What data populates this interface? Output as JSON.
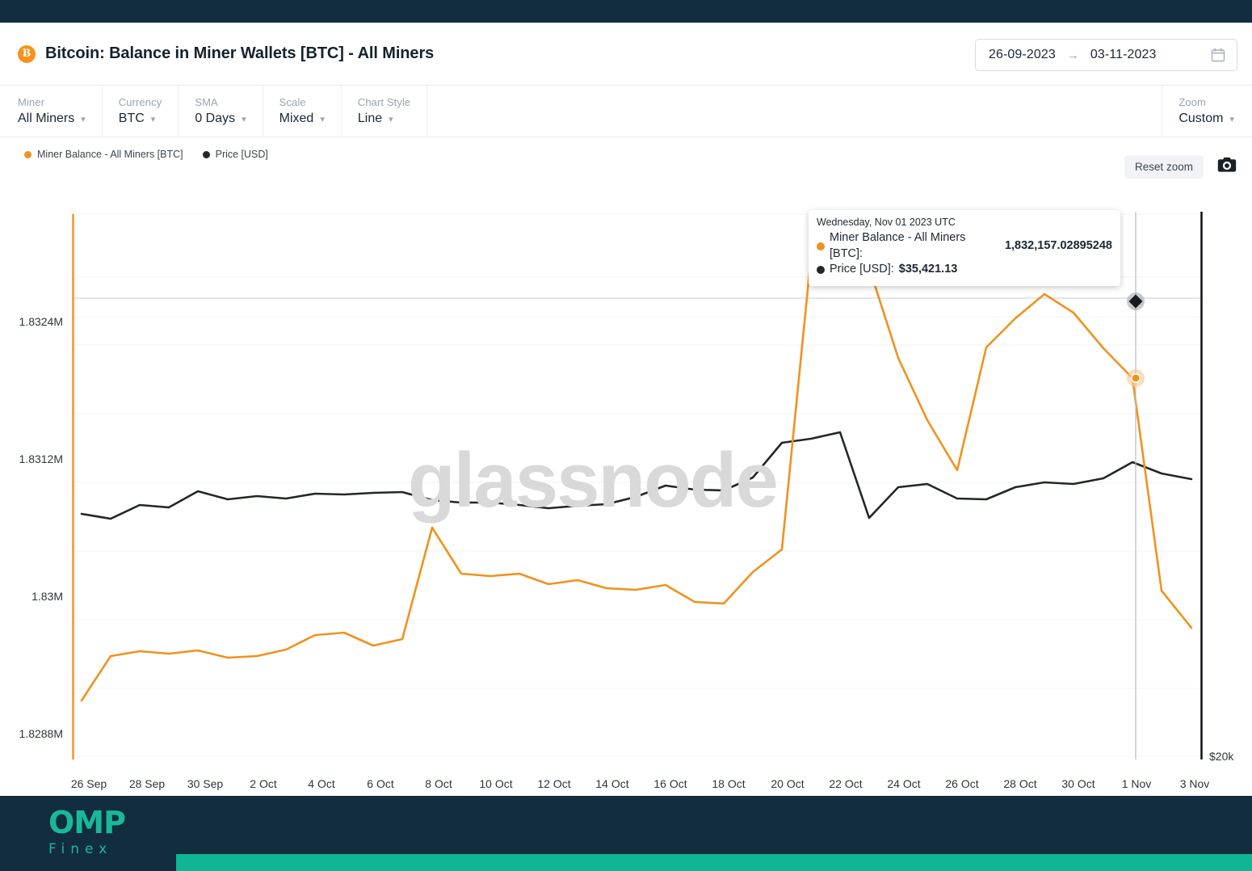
{
  "header": {
    "title": "Bitcoin: Balance in Miner Wallets [BTC] - All Miners",
    "asset_icon": "bitcoin-icon",
    "asset_glyph": "Ƀ",
    "date_from": "26-09-2023",
    "date_to": "03-11-2023",
    "date_separator": "→",
    "calendar_icon": "calendar-icon"
  },
  "controls": [
    {
      "label": "Miner",
      "value": "All Miners"
    },
    {
      "label": "Currency",
      "value": "BTC"
    },
    {
      "label": "SMA",
      "value": "0 Days"
    },
    {
      "label": "Scale",
      "value": "Mixed"
    },
    {
      "label": "Chart Style",
      "value": "Line"
    }
  ],
  "zoom_control": {
    "label": "Zoom",
    "value": "Custom"
  },
  "toolbar": {
    "reset_zoom_label": "Reset zoom",
    "camera_icon": "camera-icon"
  },
  "legend": [
    {
      "label": "Miner Balance - All Miners [BTC]",
      "color": "#f0921e"
    },
    {
      "label": "Price [USD]",
      "color": "#22272b"
    }
  ],
  "watermark": "glassnode",
  "tooltip": {
    "date": "Wednesday, Nov 01 2023 UTC",
    "rows": [
      {
        "dot_color": "#f0921e",
        "label": "Miner Balance - All Miners [BTC]:",
        "value": "1,832,157.02895248"
      },
      {
        "dot_color": "#22272b",
        "label": "Price [USD]:",
        "value": "$35,421.13"
      }
    ]
  },
  "axes": {
    "y_left_ticks": [
      "1.8324M",
      "1.8312M",
      "1.83M",
      "1.8288M"
    ],
    "y_right_ticks": [
      "$20k"
    ],
    "x_ticks": [
      "26 Sep",
      "28 Sep",
      "30 Sep",
      "2 Oct",
      "4 Oct",
      "6 Oct",
      "8 Oct",
      "10 Oct",
      "12 Oct",
      "14 Oct",
      "16 Oct",
      "18 Oct",
      "20 Oct",
      "22 Oct",
      "24 Oct",
      "26 Oct",
      "28 Oct",
      "30 Oct",
      "1 Nov",
      "3 Nov"
    ]
  },
  "footer": {
    "logo_primary": "OMP",
    "logo_secondary": "Finex",
    "brand_color": "#19b89a"
  },
  "chart_data": {
    "type": "line",
    "title": "Bitcoin: Balance in Miner Wallets [BTC] - All Miners",
    "xlabel": "",
    "ylabel": "",
    "grid": true,
    "legend_position": "top-left",
    "x": [
      "26 Sep",
      "27 Sep",
      "28 Sep",
      "29 Sep",
      "30 Sep",
      "1 Oct",
      "2 Oct",
      "3 Oct",
      "4 Oct",
      "5 Oct",
      "6 Oct",
      "7 Oct",
      "8 Oct",
      "9 Oct",
      "10 Oct",
      "11 Oct",
      "12 Oct",
      "13 Oct",
      "14 Oct",
      "15 Oct",
      "16 Oct",
      "17 Oct",
      "18 Oct",
      "19 Oct",
      "20 Oct",
      "21 Oct",
      "22 Oct",
      "23 Oct",
      "24 Oct",
      "25 Oct",
      "26 Oct",
      "27 Oct",
      "28 Oct",
      "29 Oct",
      "30 Oct",
      "31 Oct",
      "1 Nov",
      "2 Nov",
      "3 Nov"
    ],
    "series": [
      {
        "name": "Miner Balance - All Miners [BTC]",
        "color": "#f0921e",
        "axis": "left",
        "ylim": [
          1828800,
          1833600
        ],
        "yticks": [
          1832400,
          1831200,
          1830000,
          1828800
        ],
        "values": [
          1829195,
          1829475,
          1829620,
          1829570,
          1829680,
          1829510,
          1829540,
          1829680,
          1829990,
          1830030,
          1829800,
          1829935,
          1830820,
          1830450,
          1830430,
          1830440,
          1830300,
          1830360,
          1830245,
          1830230,
          1830290,
          1830110,
          1830090,
          1830450,
          1830620,
          1833060,
          1833060,
          1832940,
          1832320,
          1831600,
          1831070,
          1832510,
          1832890,
          1833180,
          1832950,
          1832560,
          1832157,
          1830100,
          1829850
        ]
      },
      {
        "name": "Price [USD]",
        "color": "#22272b",
        "axis": "right",
        "ylim_label": "$20k",
        "values": [
          26200,
          26250,
          26420,
          26400,
          26890,
          26780,
          26820,
          26760,
          26870,
          26860,
          26880,
          26700,
          26540,
          26550,
          26550,
          26500,
          26480,
          26560,
          26630,
          26900,
          27180,
          27070,
          27050,
          27420,
          28400,
          28600,
          28700,
          29800,
          30800,
          30770,
          30540,
          30620,
          30860,
          31100,
          30950,
          31300,
          35421,
          35050,
          34900
        ]
      }
    ],
    "highlight": {
      "x": "1 Nov",
      "miner_balance": 1832157.02895248,
      "price": 35421.13
    }
  }
}
